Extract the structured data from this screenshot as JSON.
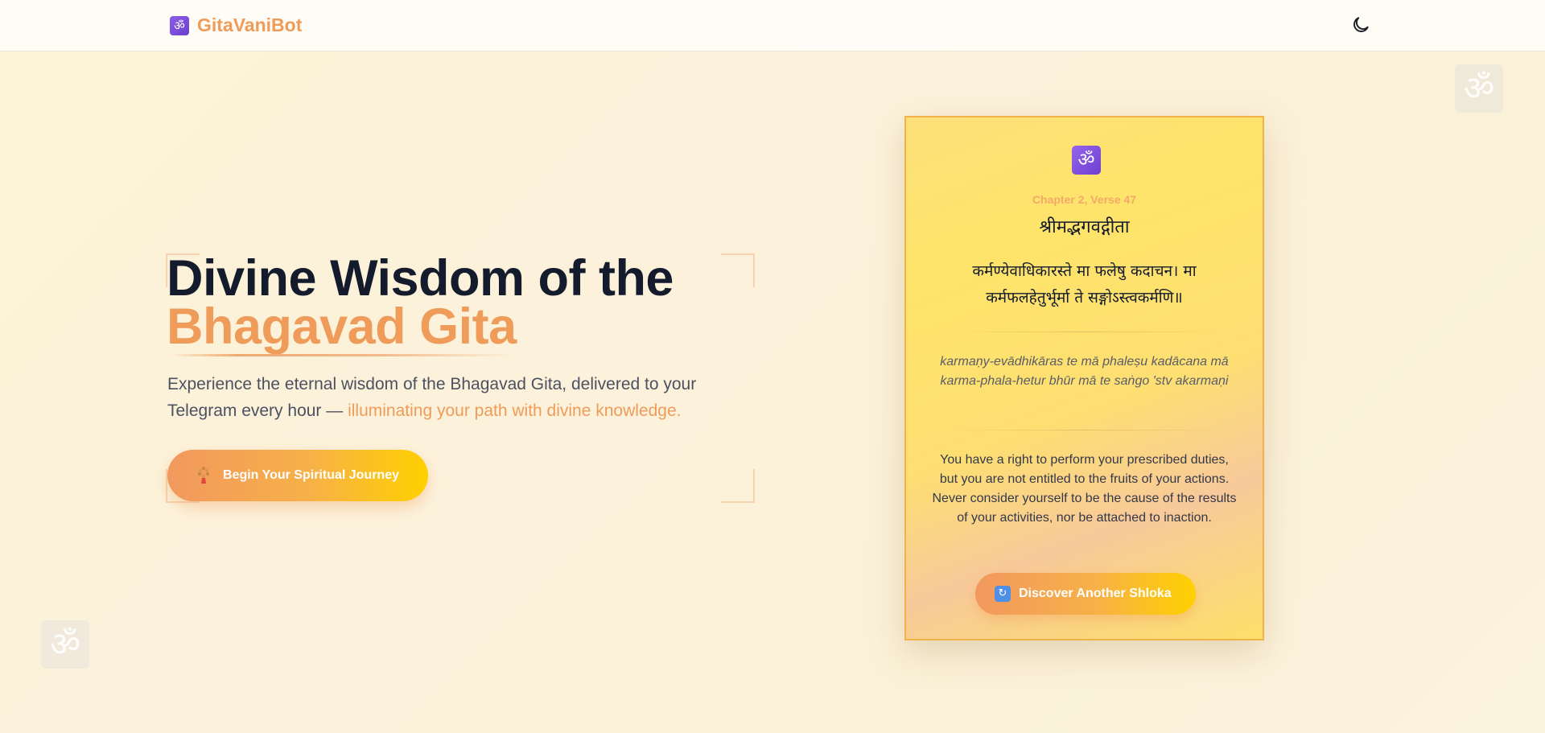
{
  "navbar": {
    "brand_icon": "om-icon",
    "brand_icon_glyph": "ॐ",
    "brand_name": "GitaVaniBot",
    "theme_toggle_icon": "moon-icon"
  },
  "decorations": {
    "om_glyph": "ॐ"
  },
  "hero": {
    "title_line1": "Divine Wisdom of the",
    "title_line2": "Bhagavad Gita",
    "subtitle_plain": "Experience the eternal wisdom of the Bhagavad Gita, delivered to your Telegram every hour — ",
    "subtitle_highlight": "illuminating your path with divine knowledge.",
    "cta_icon": "prayer-beads-icon",
    "cta_label": "Begin Your Spiritual Journey"
  },
  "shloka_card": {
    "icon": "om-icon",
    "icon_glyph": "ॐ",
    "chapter_verse": "Chapter 2, Verse 47",
    "title": "श्रीमद्भगवद्गीता",
    "sanskrit_line1": "कर्मण्येवाधिकारस्ते मा फलेषु कदाचन। मा",
    "sanskrit_line2": "कर्मफलहेतुर्भूर्मा ते सङ्गोऽस्त्वकर्मणि॥",
    "transliteration": "karmaṇy-evādhikāras te mā phaleṣu kadācana mā karma-phala-hetur bhūr mā te saṅgo 'stv akarmaṇi",
    "translation": "You have a right to perform your prescribed duties, but you are not entitled to the fruits of your actions. Never consider yourself to be the cause of the results of your activities, nor be attached to inaction.",
    "button_icon": "refresh-icon",
    "button_icon_glyph": "↻",
    "button_label": "Discover Another Shloka"
  },
  "colors": {
    "accent": "#ef9b5a",
    "heading": "#141b2d",
    "gradient_start": "#f2985e",
    "gradient_end": "#ffd000",
    "card_border": "#f2b24a"
  }
}
